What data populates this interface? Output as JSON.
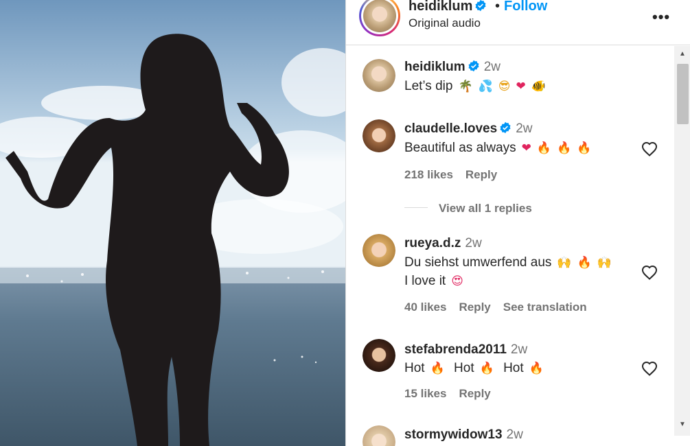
{
  "post_header": {
    "username": "heidiklum",
    "separator": "•",
    "follow_label": "Follow",
    "audio": "Original audio",
    "more_label": "•••"
  },
  "comments": [
    {
      "username": "heidiklum",
      "verified": true,
      "time": "2w",
      "text": "Let’s dip",
      "emojis": [
        "🌴",
        "💦",
        "😎",
        "❤",
        "🐠"
      ]
    },
    {
      "username": "claudelle.loves",
      "verified": true,
      "time": "2w",
      "text": "Beautiful as always",
      "emojis": [
        "❤",
        "🔥",
        "🔥",
        "🔥"
      ],
      "likes": "218 likes",
      "reply_label": "Reply",
      "view_replies": "View all 1 replies"
    },
    {
      "username": "rueya.d.z",
      "time": "2w",
      "text": "Du siehst umwerfend aus",
      "emojis": [
        "🙌",
        "🔥",
        "🙌"
      ],
      "text2": "I love it",
      "emojis2": [
        "😍"
      ],
      "likes": "40 likes",
      "reply_label": "Reply",
      "translation_label": "See translation"
    },
    {
      "username": "stefabrenda2011",
      "time": "2w",
      "text_parts": [
        "Hot",
        "Hot",
        "Hot"
      ],
      "emoji": "🔥",
      "likes": "15 likes",
      "reply_label": "Reply"
    },
    {
      "username": "stormywidow13",
      "time": "2w"
    }
  ],
  "colors": {
    "link_blue": "#0095f6",
    "verified_blue": "#0095f6",
    "secondary_text": "#737373"
  }
}
